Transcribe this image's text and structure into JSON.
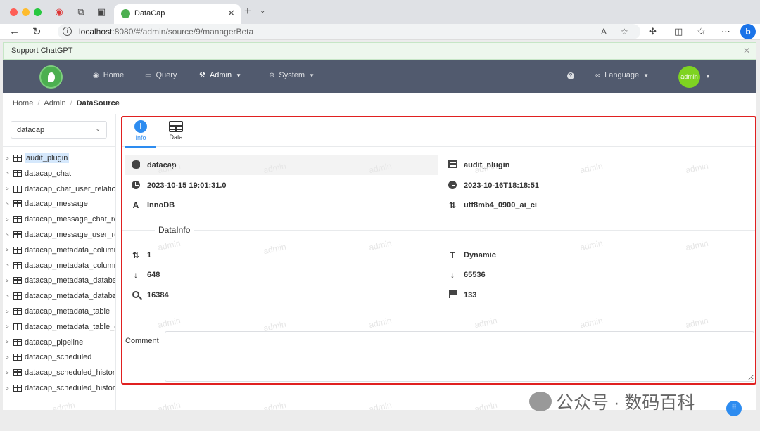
{
  "browser": {
    "tab_title": "DataCap",
    "url_host": "localhost",
    "url_rest": ":8080/#/admin/source/9/managerBeta"
  },
  "notice": {
    "text": "Support ChatGPT"
  },
  "nav": {
    "items": [
      {
        "label": "Home",
        "icon": "home-icon"
      },
      {
        "label": "Query",
        "icon": "query-icon"
      },
      {
        "label": "Admin",
        "icon": "admin-icon"
      },
      {
        "label": "System",
        "icon": "system-icon"
      }
    ],
    "language": "Language",
    "avatar": "admin"
  },
  "breadcrumb": [
    "Home",
    "Admin",
    "DataSource"
  ],
  "database_select": "datacap",
  "tree": [
    "audit_plugin",
    "datacap_chat",
    "datacap_chat_user_relation",
    "datacap_message",
    "datacap_message_chat_rela",
    "datacap_message_user_rela",
    "datacap_metadata_column",
    "datacap_metadata_column_",
    "datacap_metadata_databas",
    "datacap_metadata_databas",
    "datacap_metadata_table",
    "datacap_metadata_table_da",
    "datacap_pipeline",
    "datacap_scheduled",
    "datacap_scheduled_history",
    "datacap_scheduled_history"
  ],
  "tabs": [
    "Info",
    "Data"
  ],
  "info": {
    "database": "datacap",
    "table": "audit_plugin",
    "create_time": "2023-10-15 19:01:31.0",
    "update_time": "2023-10-16T18:18:51",
    "engine": "InnoDB",
    "collation": "utf8mb4_0900_ai_ci"
  },
  "datainfo": {
    "title": "DataInfo",
    "rows": "1",
    "format": "Dynamic",
    "avg_row_length": "648",
    "auto_increment": "65536",
    "data_length": "16384",
    "flag_value": "133"
  },
  "comment_label": "Comment",
  "watermark": "admin",
  "wechat": "公众号 · 数码百科"
}
